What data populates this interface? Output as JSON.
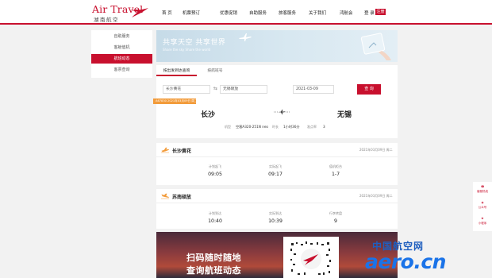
{
  "header": {
    "logo_en": "Air Travel",
    "logo_cn": "湖南航空",
    "nav": [
      "首 页",
      "机票预订",
      "优惠促销",
      "自助服务",
      "旅客服务",
      "关于我们",
      "鸿航会"
    ],
    "login": "登 录",
    "register": "注册",
    "brand_color": "#c8102e"
  },
  "sidebar": {
    "items": [
      {
        "label": "自助服务",
        "active": false
      },
      {
        "label": "客舱值机",
        "active": false
      },
      {
        "label": "航班动态",
        "active": true
      },
      {
        "label": "客票查询",
        "active": false
      }
    ]
  },
  "banner": {
    "title": "共享天空 共享世界",
    "subtitle": "Share the sky  Share the world"
  },
  "search": {
    "tabs": [
      "按出发到达查询",
      "按航班号"
    ],
    "from_value": "长沙黄花",
    "to_value": "无锡硕放",
    "date_value": "2021-03-09",
    "button": "查 询"
  },
  "flight": {
    "tag": "A67830 2021年03月09日 周二",
    "origin": "长沙",
    "destination": "无锡",
    "aircraft_label": "机型",
    "aircraft_value": "空客A320-251N neo",
    "duration_label": "时长",
    "duration_value": "1小时36分",
    "ontime_label": "准点率",
    "ontime_value": "3"
  },
  "stations": [
    {
      "name": "长沙黄花",
      "date": "2021年03月09日 周二",
      "cols": [
        {
          "label": "计划起飞",
          "value": "09:05"
        },
        {
          "label": "实际起飞",
          "value": "09:17"
        },
        {
          "label": "值机柜台",
          "value": "1-7"
        }
      ]
    },
    {
      "name": "苏南硕放",
      "date": "2021年03月09日 周二",
      "cols": [
        {
          "label": "计划到达",
          "value": "10:40"
        },
        {
          "label": "实际到达",
          "value": "10:39"
        },
        {
          "label": "行李转盘",
          "value": "9"
        }
      ]
    }
  ],
  "promo": {
    "line1": "扫码随时随地",
    "line2": "查询航班动态"
  },
  "float_bar": {
    "items": [
      "客服热线",
      "公众号",
      "小程序"
    ]
  },
  "watermark": {
    "cn": "中国航空网",
    "en": "aero.cn"
  }
}
